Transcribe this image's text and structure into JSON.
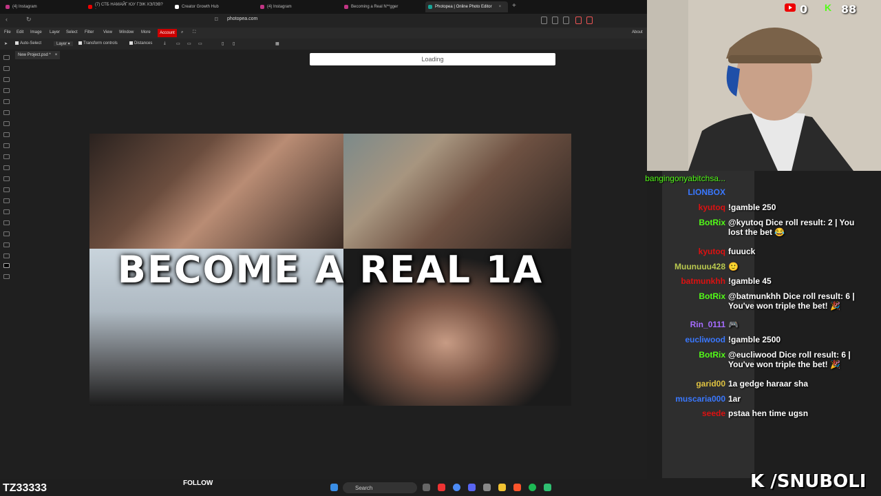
{
  "browser": {
    "tabs": [
      {
        "label": "(4) Instagram",
        "active": false
      },
      {
        "label": "(7) СТБ НАМАЙГ ЮУ ГЭЖ ХЭЛЭВ? ·",
        "active": false
      },
      {
        "label": "Creator Growth Hub",
        "active": false
      },
      {
        "label": "(4) Instagram",
        "active": false
      },
      {
        "label": "Becoming a Real N**gger",
        "active": false
      },
      {
        "label": "Photopea | Online Photo Editor",
        "active": true
      }
    ],
    "new_tab": "+",
    "url": "photopea.com"
  },
  "photopea": {
    "menu": [
      "File",
      "Edit",
      "Image",
      "Layer",
      "Select",
      "Filter",
      "View",
      "Window",
      "More"
    ],
    "account": "Account",
    "about": "About",
    "options": {
      "auto_select": "Auto-Select",
      "layer_select": "Layer",
      "transform_controls": "Transform controls",
      "distances": "Distances"
    },
    "document_tab": "New Project.psd *",
    "document_close": "×",
    "loading": "Loading",
    "canvas_text": "BECOME A REAL 1A"
  },
  "stream": {
    "youtube_count": "0",
    "kick_count": "88",
    "chat_header": "bangingonyabitchsa...",
    "chat": [
      {
        "name": "LIONBOX",
        "color": "#3a78ff",
        "msg": ""
      },
      {
        "name": "kyutoq",
        "color": "#d11",
        "msg": "!gamble 250"
      },
      {
        "name": "BotRix",
        "color": "#53fc18",
        "msg": "@kyutoq Dice roll result: 2 | You lost the bet 😂"
      },
      {
        "name": "kyutoq",
        "color": "#d11",
        "msg": "fuuuck"
      },
      {
        "name": "Muunuuu428",
        "color": "#b9c94f",
        "msg": "🙂"
      },
      {
        "name": "batmunkhh",
        "color": "#d11",
        "msg": "!gamble 45"
      },
      {
        "name": "BotRix",
        "color": "#53fc18",
        "msg": "@batmunkhh Dice roll result: 6 | You've won triple the bet! 🎉"
      },
      {
        "name": "Rin_0111",
        "color": "#a66cff",
        "msg": "🎮"
      },
      {
        "name": "eucliwood",
        "color": "#3a78ff",
        "msg": "!gamble 2500"
      },
      {
        "name": "BotRix",
        "color": "#53fc18",
        "msg": "@eucliwood Dice roll result: 6 | You've won triple the bet! 🎉"
      },
      {
        "name": "garid00",
        "color": "#e0c341",
        "msg": "1a gedge haraar sha"
      },
      {
        "name": "muscaria000",
        "color": "#3a78ff",
        "msg": "1ar"
      },
      {
        "name": "seede",
        "color": "#d11",
        "msg": "pstaa hen time ugsn"
      }
    ],
    "streamer_name": "TZ33333",
    "follow": "FOLLOW",
    "watermark": "K /SNUBOLI"
  },
  "taskbar": {
    "search": "Search"
  }
}
